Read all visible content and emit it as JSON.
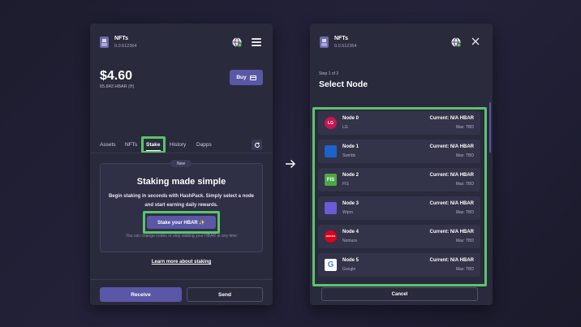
{
  "left_panel": {
    "account": {
      "name": "NFTs",
      "id": "0.0.512364"
    },
    "balance": {
      "usd": "$4.60",
      "hbar": "65.843 HBAR (ℏ)"
    },
    "buy_label": "Buy",
    "tabs": [
      {
        "label": "Assets"
      },
      {
        "label": "NFTs"
      },
      {
        "label": "Stake"
      },
      {
        "label": "History"
      },
      {
        "label": "Dapps"
      }
    ],
    "active_tab": "Stake",
    "stake_card": {
      "badge": "New",
      "title": "Staking made simple",
      "description": "Begin staking in seconds with HashPack. Simply select a node and start earning daily rewards.",
      "button": "Stake your HBAR ✨",
      "footnote": "You can change nodes or stop staking your HBAR at any time"
    },
    "learn_more": "Learn more about staking",
    "receive_label": "Receive",
    "send_label": "Send"
  },
  "right_panel": {
    "account": {
      "name": "NFTs",
      "id": "0.0.512364"
    },
    "step": "Step 1 of 2",
    "title": "Select Node",
    "nodes": [
      {
        "name": "Node 0",
        "org": "LG",
        "current": "Current: N/A HBAR",
        "max": "Max: TBD",
        "logo_text": "LG",
        "logo_color": "#c8164f"
      },
      {
        "name": "Node 1",
        "org": "Swirlds",
        "current": "Current: N/A HBAR",
        "max": "Max: TBD",
        "logo_text": "",
        "logo_color": "#1a63c9"
      },
      {
        "name": "Node 2",
        "org": "FIS",
        "current": "Current: N/A HBAR",
        "max": "Max: TBD",
        "logo_text": "FIS",
        "logo_color": "#4ca845"
      },
      {
        "name": "Node 3",
        "org": "Wipro",
        "current": "Current: N/A HBAR",
        "max": "Max: TBD",
        "logo_text": "",
        "logo_color": "#6c5bd6"
      },
      {
        "name": "Node 4",
        "org": "Nomura",
        "current": "Current: N/A HBAR",
        "max": "Max: TBD",
        "logo_text": "NOMURA",
        "logo_color": "#e0001b"
      },
      {
        "name": "Node 5",
        "org": "Google",
        "current": "Current: N/A HBAR",
        "max": "Max: TBD",
        "logo_text": "G",
        "logo_color": "#4285f4"
      }
    ],
    "cancel_label": "Cancel"
  },
  "colors": {
    "background": "#1f1e30",
    "panel": "#2a2a3d",
    "accent": "#5a57a6",
    "highlight": "#5bc46a"
  },
  "icons": [
    "account-icon",
    "globe-icon",
    "menu-icon",
    "close-icon",
    "card-icon",
    "refresh-icon",
    "arrow-right-icon"
  ]
}
